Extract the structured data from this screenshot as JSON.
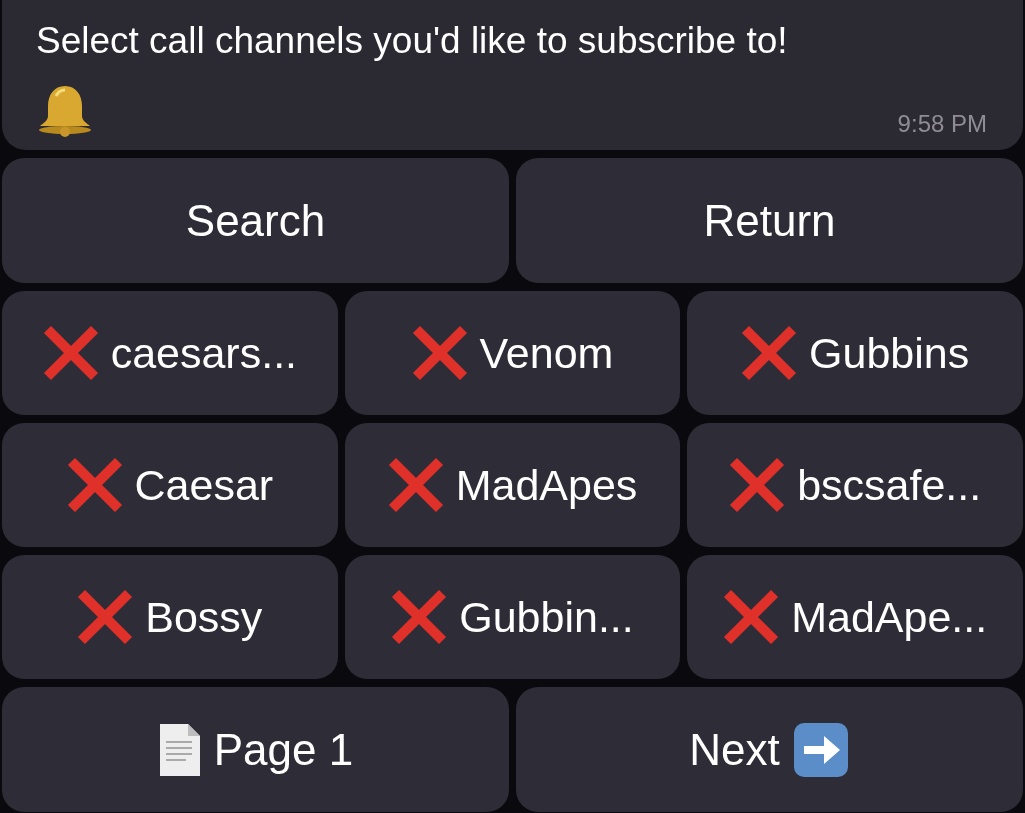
{
  "message": {
    "text": "Select call channels you'd like to subscribe to!",
    "time": "9:58 PM"
  },
  "top_buttons": [
    {
      "label": "Search"
    },
    {
      "label": "Return"
    }
  ],
  "channels": [
    {
      "label": "caesars...",
      "subscribed": false
    },
    {
      "label": "Venom",
      "subscribed": false
    },
    {
      "label": "Gubbins",
      "subscribed": false
    },
    {
      "label": "Caesar",
      "subscribed": false
    },
    {
      "label": "MadApes",
      "subscribed": false
    },
    {
      "label": "bscsafe...",
      "subscribed": false
    },
    {
      "label": "Bossy",
      "subscribed": false
    },
    {
      "label": "Gubbin...",
      "subscribed": false
    },
    {
      "label": "MadApe...",
      "subscribed": false
    }
  ],
  "bottom_buttons": [
    {
      "label": "Page 1",
      "kind": "page"
    },
    {
      "label": "Next",
      "kind": "next"
    }
  ]
}
